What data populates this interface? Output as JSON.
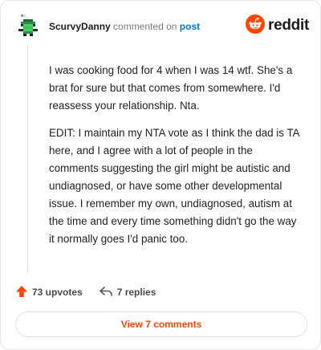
{
  "header": {
    "username": "ScurvyDanny",
    "action_text": "commented on",
    "post_link": "post",
    "brand": "reddit"
  },
  "comment": {
    "paragraphs": [
      "I was cooking food for 4 when I was 14 wtf. She's a brat for sure but that comes from somewhere. I'd reassess your relationship. Nta.",
      "EDIT: I maintain my NTA vote as I think the dad is TA here, and I agree with a lot of people in the comments suggesting the girl might be autistic and undiagnosed, or have some other developmental issue. I remember my own, undiagnosed, autism at the time and every time something didn't go the way it normally goes I'd panic too."
    ]
  },
  "actions": {
    "upvotes_label": "73 upvotes",
    "replies_label": "7 replies"
  },
  "footer": {
    "view_comments_label": "View 7 comments"
  },
  "colors": {
    "accent": "#ff4500",
    "link": "#0079d3",
    "avatar_green": "#46d160"
  }
}
